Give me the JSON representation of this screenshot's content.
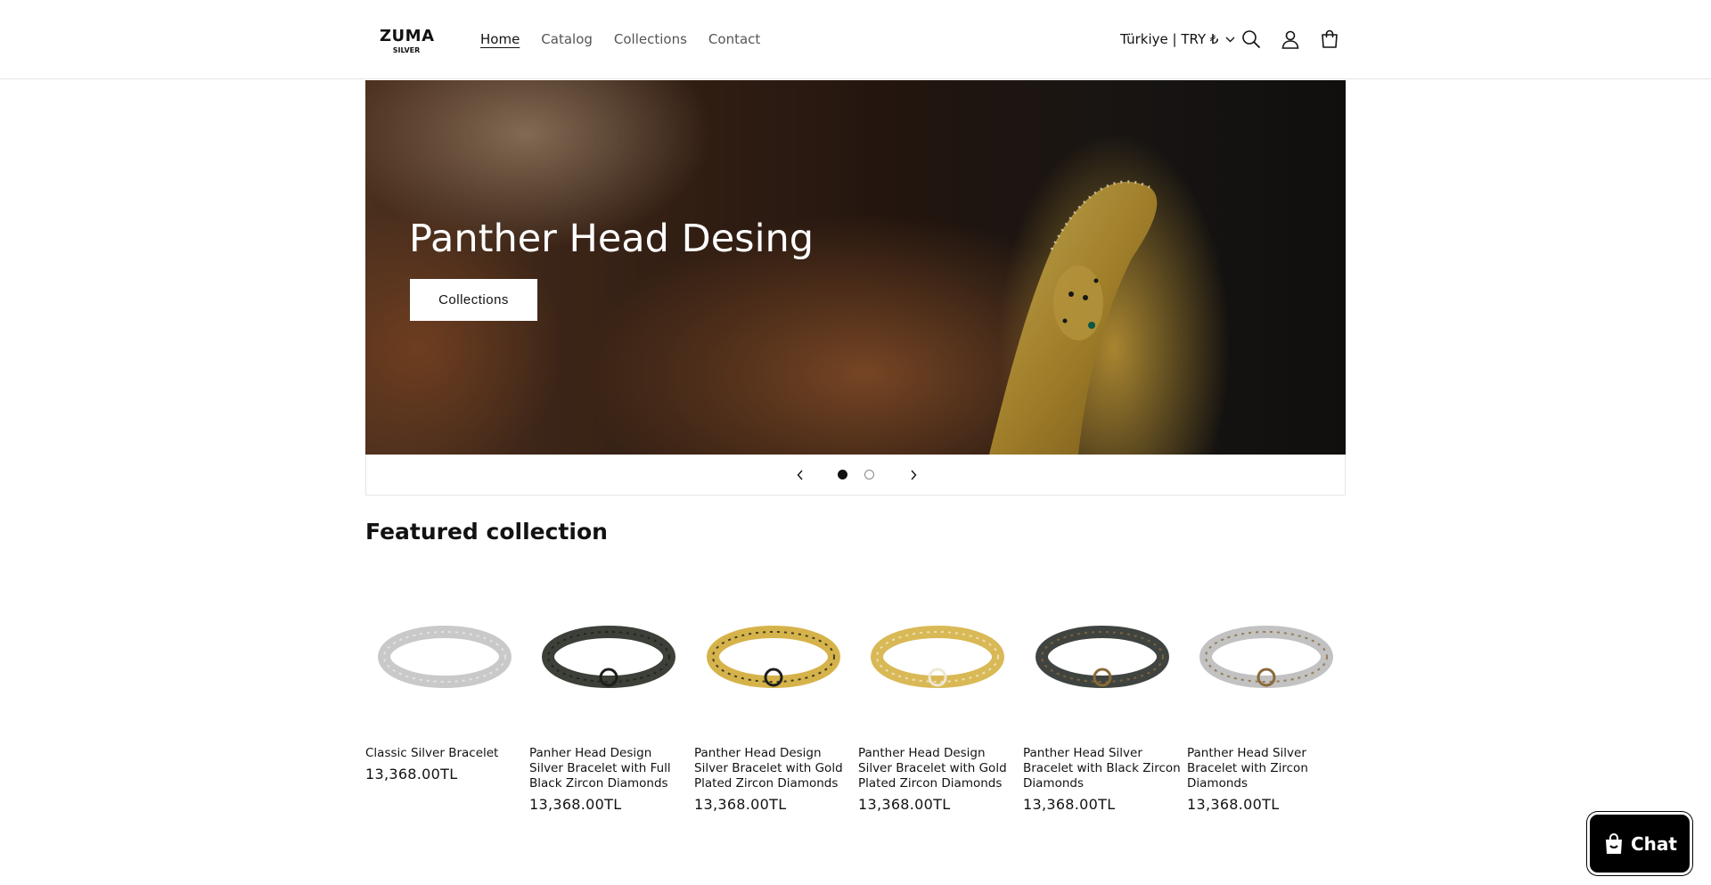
{
  "header": {
    "logo": {
      "main": "ZUMA",
      "sub": "SILVER"
    },
    "nav": [
      {
        "label": "Home",
        "active": true
      },
      {
        "label": "Catalog",
        "active": false
      },
      {
        "label": "Collections",
        "active": false
      },
      {
        "label": "Contact",
        "active": false
      }
    ],
    "locale": "Türkiye | TRY ₺",
    "icons": [
      "search-icon",
      "account-icon",
      "cart-icon"
    ]
  },
  "hero": {
    "title": "Panther Head Desing",
    "button": "Collections",
    "slides": {
      "current": 1,
      "total": 2
    }
  },
  "featured": {
    "title": "Featured collection",
    "products": [
      {
        "name": "Classic Silver Bracelet",
        "price": "13,368.00TL",
        "color": "#c9c9c9",
        "accent": "#e8e8e8"
      },
      {
        "name": "Panher Head Design Silver Bracelet with Full Black Zircon Diamonds",
        "price": "13,368.00TL",
        "color": "#3c4038",
        "accent": "#1d1f1b"
      },
      {
        "name": "Panther Head Design Silver Bracelet with Gold Plated Zircon Diamonds",
        "price": "13,368.00TL",
        "color": "#d6b34a",
        "accent": "#1d1f1b"
      },
      {
        "name": "Panther Head Design Silver Bracelet with Gold Plated Zircon Diamonds",
        "price": "13,368.00TL",
        "color": "#d9b956",
        "accent": "#efe7d0"
      },
      {
        "name": "Panther Head Silver Bracelet with Black Zircon Diamonds",
        "price": "13,368.00TL",
        "color": "#404440",
        "accent": "#8a6a3a"
      },
      {
        "name": "Panther Head Silver Bracelet with Zircon Diamonds",
        "price": "13,368.00TL",
        "color": "#c2c2c2",
        "accent": "#8a6a3a"
      }
    ]
  },
  "chat": {
    "label": "Chat"
  }
}
